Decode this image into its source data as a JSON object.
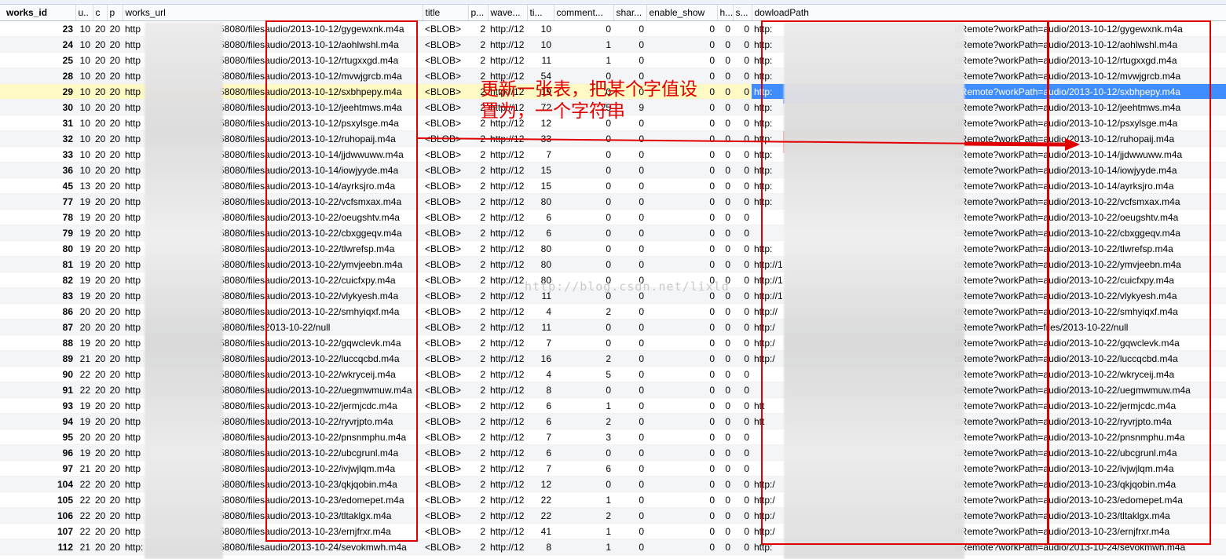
{
  "columns": [
    "works_id",
    "u..",
    "c",
    "p",
    "works_url",
    "title",
    "p...",
    "wave...",
    "ti...",
    "comment...",
    "shar...",
    "enable_show",
    "h...",
    "s...",
    "dowloadPath"
  ],
  "rows": [
    {
      "id": "23",
      "u": "10",
      "c": "20",
      "p": "20",
      "url_pre": "http",
      "url_mid": "58080/files",
      "url_path": "audio/2013-10-12/gygewxnk.m4a",
      "title": "<BLOB>",
      "p2": "2",
      "wave": "http://12",
      "ti": "10",
      "comment": "0",
      "share": "0",
      "enable": "0",
      "h": "0",
      "s": "0",
      "dl_pre": "http:",
      "dl_mid": "dRemote?workPath=",
      "dl_path": "audio/2013-10-12/gygewxnk.m4a"
    },
    {
      "id": "24",
      "u": "10",
      "c": "20",
      "p": "20",
      "url_pre": "http",
      "url_mid": "58080/files",
      "url_path": "audio/2013-10-12/aohlwshl.m4a",
      "title": "<BLOB>",
      "p2": "2",
      "wave": "http://12",
      "ti": "10",
      "comment": "1",
      "share": "0",
      "enable": "0",
      "h": "0",
      "s": "0",
      "dl_pre": "http:",
      "dl_mid": "dRemote?workPath=",
      "dl_path": "audio/2013-10-12/aohlwshl.m4a"
    },
    {
      "id": "25",
      "u": "10",
      "c": "20",
      "p": "20",
      "url_pre": "http",
      "url_mid": "58080/files",
      "url_path": "audio/2013-10-12/rtugxxgd.m4a",
      "title": "<BLOB>",
      "p2": "2",
      "wave": "http://12",
      "ti": "11",
      "comment": "1",
      "share": "0",
      "enable": "0",
      "h": "0",
      "s": "0",
      "dl_pre": "http:",
      "dl_mid": "dRemote?workPath=",
      "dl_path": "audio/2013-10-12/rtugxxgd.m4a"
    },
    {
      "id": "28",
      "u": "10",
      "c": "20",
      "p": "20",
      "url_pre": "http",
      "url_mid": "58080/files",
      "url_path": "audio/2013-10-12/mvwjgrcb.m4a",
      "title": "<BLOB>",
      "p2": "2",
      "wave": "http://12",
      "ti": "54",
      "comment": "0",
      "share": "0",
      "enable": "0",
      "h": "0",
      "s": "0",
      "dl_pre": "http:",
      "dl_mid": "dRemote?workPath=",
      "dl_path": "audio/2013-10-12/mvwjgrcb.m4a"
    },
    {
      "id": "29",
      "u": "10",
      "c": "20",
      "p": "20",
      "url_pre": "http",
      "url_mid": "58080/files",
      "url_path": "audio/2013-10-12/sxbhpepy.m4a",
      "title": "<BLOB>",
      "p2": "2",
      "wave": "http://12",
      "ti": "19",
      "comment": "0",
      "share": "0",
      "enable": "0",
      "h": "0",
      "s": "0",
      "dl_pre": "http:",
      "dl_mid": "dRemote?workPath=",
      "dl_path": "audio/2013-10-12/sxbhpepy.m4a"
    },
    {
      "id": "30",
      "u": "10",
      "c": "20",
      "p": "20",
      "url_pre": "http",
      "url_mid": "58080/files",
      "url_path": "audio/2013-10-12/jeehtmws.m4a",
      "title": "<BLOB>",
      "p2": "2",
      "wave": "http://12",
      "ti": "72",
      "comment": "25",
      "share": "9",
      "enable": "0",
      "h": "0",
      "s": "0",
      "dl_pre": "http:",
      "dl_mid": "dRemote?workPath=",
      "dl_path": "audio/2013-10-12/jeehtmws.m4a"
    },
    {
      "id": "31",
      "u": "10",
      "c": "20",
      "p": "20",
      "url_pre": "http",
      "url_mid": "58080/files",
      "url_path": "audio/2013-10-12/psxylsge.m4a",
      "title": "<BLOB>",
      "p2": "2",
      "wave": "http://12",
      "ti": "12",
      "comment": "0",
      "share": "0",
      "enable": "0",
      "h": "0",
      "s": "0",
      "dl_pre": "http:",
      "dl_mid": "dRemote?workPath=",
      "dl_path": "audio/2013-10-12/psxylsge.m4a"
    },
    {
      "id": "32",
      "u": "10",
      "c": "20",
      "p": "20",
      "url_pre": "http",
      "url_mid": "58080/files",
      "url_path": "audio/2013-10-12/ruhopaij.m4a",
      "title": "<BLOB>",
      "p2": "2",
      "wave": "http://12",
      "ti": "33",
      "comment": "0",
      "share": "0",
      "enable": "0",
      "h": "0",
      "s": "0",
      "dl_pre": "http:",
      "dl_mid": "dRemote?workPath=",
      "dl_path": "audio/2013-10-12/ruhopaij.m4a"
    },
    {
      "id": "33",
      "u": "10",
      "c": "20",
      "p": "20",
      "url_pre": "http",
      "url_mid": "58080/files",
      "url_path": "audio/2013-10-14/jjdwwuww.m4a",
      "title": "<BLOB>",
      "p2": "2",
      "wave": "http://12",
      "ti": "7",
      "comment": "0",
      "share": "0",
      "enable": "0",
      "h": "0",
      "s": "0",
      "dl_pre": "http:",
      "dl_mid": "dRemote?workPath=",
      "dl_path": "audio/2013-10-14/jjdwwuww.m4a"
    },
    {
      "id": "36",
      "u": "10",
      "c": "20",
      "p": "20",
      "url_pre": "http",
      "url_mid": "58080/files",
      "url_path": "audio/2013-10-14/iowjyyde.m4a",
      "title": "<BLOB>",
      "p2": "2",
      "wave": "http://12",
      "ti": "15",
      "comment": "0",
      "share": "0",
      "enable": "0",
      "h": "0",
      "s": "0",
      "dl_pre": "http:",
      "dl_mid": "dRemote?workPath=",
      "dl_path": "audio/2013-10-14/iowjyyde.m4a"
    },
    {
      "id": "45",
      "u": "13",
      "c": "20",
      "p": "20",
      "url_pre": "http",
      "url_mid": "58080/files",
      "url_path": "audio/2013-10-14/ayrksjro.m4a",
      "title": "<BLOB>",
      "p2": "2",
      "wave": "http://12",
      "ti": "15",
      "comment": "0",
      "share": "0",
      "enable": "0",
      "h": "0",
      "s": "0",
      "dl_pre": "http:",
      "dl_mid": "dRemote?workPath=",
      "dl_path": "audio/2013-10-14/ayrksjro.m4a"
    },
    {
      "id": "77",
      "u": "19",
      "c": "20",
      "p": "20",
      "url_pre": "http",
      "url_mid": "58080/files",
      "url_path": "audio/2013-10-22/vcfsmxax.m4a",
      "title": "<BLOB>",
      "p2": "2",
      "wave": "http://12",
      "ti": "80",
      "comment": "0",
      "share": "0",
      "enable": "0",
      "h": "0",
      "s": "0",
      "dl_pre": "http:",
      "dl_mid": "dRemote?workPath=",
      "dl_path": "audio/2013-10-22/vcfsmxax.m4a"
    },
    {
      "id": "78",
      "u": "19",
      "c": "20",
      "p": "20",
      "url_pre": "http",
      "url_mid": "58080/files",
      "url_path": "audio/2013-10-22/oeugshtv.m4a",
      "title": "<BLOB>",
      "p2": "2",
      "wave": "http://12",
      "ti": "6",
      "comment": "0",
      "share": "0",
      "enable": "0",
      "h": "0",
      "s": "0",
      "dl_pre": "",
      "dl_mid": "dRemote?workPath=",
      "dl_path": "audio/2013-10-22/oeugshtv.m4a"
    },
    {
      "id": "79",
      "u": "19",
      "c": "20",
      "p": "20",
      "url_pre": "http",
      "url_mid": "58080/files",
      "url_path": "audio/2013-10-22/cbxggeqv.m4a",
      "title": "<BLOB>",
      "p2": "2",
      "wave": "http://12",
      "ti": "6",
      "comment": "0",
      "share": "0",
      "enable": "0",
      "h": "0",
      "s": "0",
      "dl_pre": "",
      "dl_mid": "dRemote?workPath=",
      "dl_path": "audio/2013-10-22/cbxggeqv.m4a"
    },
    {
      "id": "80",
      "u": "19",
      "c": "20",
      "p": "20",
      "url_pre": "http",
      "url_mid": "58080/files",
      "url_path": "audio/2013-10-22/tlwrefsp.m4a",
      "title": "<BLOB>",
      "p2": "2",
      "wave": "http://12",
      "ti": "80",
      "comment": "0",
      "share": "0",
      "enable": "0",
      "h": "0",
      "s": "0",
      "dl_pre": "http:",
      "dl_mid": "dRemote?workPath=",
      "dl_path": "audio/2013-10-22/tlwrefsp.m4a"
    },
    {
      "id": "81",
      "u": "19",
      "c": "20",
      "p": "20",
      "url_pre": "http",
      "url_mid": "58080/files",
      "url_path": "audio/2013-10-22/ymvjeebn.m4a",
      "title": "<BLOB>",
      "p2": "2",
      "wave": "http://12",
      "ti": "80",
      "comment": "0",
      "share": "0",
      "enable": "0",
      "h": "0",
      "s": "0",
      "dl_pre": "http://1",
      "dl_mid": "dRemote?workPath=",
      "dl_path": "audio/2013-10-22/ymvjeebn.m4a"
    },
    {
      "id": "82",
      "u": "19",
      "c": "20",
      "p": "20",
      "url_pre": "http",
      "url_mid": "58080/files",
      "url_path": "audio/2013-10-22/cuicfxpy.m4a",
      "title": "<BLOB>",
      "p2": "2",
      "wave": "http://12",
      "ti": "80",
      "comment": "0",
      "share": "0",
      "enable": "0",
      "h": "0",
      "s": "0",
      "dl_pre": "http://1",
      "dl_mid": "dRemote?workPath=",
      "dl_path": "audio/2013-10-22/cuicfxpy.m4a"
    },
    {
      "id": "83",
      "u": "19",
      "c": "20",
      "p": "20",
      "url_pre": "http",
      "url_mid": "58080/files",
      "url_path": "audio/2013-10-22/vlykyesh.m4a",
      "title": "<BLOB>",
      "p2": "2",
      "wave": "http://12",
      "ti": "11",
      "comment": "0",
      "share": "0",
      "enable": "0",
      "h": "0",
      "s": "0",
      "dl_pre": "http://1",
      "dl_mid": "dRemote?workPath=",
      "dl_path": "audio/2013-10-22/vlykyesh.m4a"
    },
    {
      "id": "86",
      "u": "20",
      "c": "20",
      "p": "20",
      "url_pre": "http",
      "url_mid": "58080/files",
      "url_path": "audio/2013-10-22/smhyiqxf.m4a",
      "title": "<BLOB>",
      "p2": "2",
      "wave": "http://12",
      "ti": "4",
      "comment": "2",
      "share": "0",
      "enable": "0",
      "h": "0",
      "s": "0",
      "dl_pre": "http://",
      "dl_mid": "dRemote?workPath=",
      "dl_path": "audio/2013-10-22/smhyiqxf.m4a"
    },
    {
      "id": "87",
      "u": "20",
      "c": "20",
      "p": "20",
      "url_pre": "http",
      "url_mid": "58080/files",
      "url_path": "2013-10-22/null",
      "title": "<BLOB>",
      "p2": "2",
      "wave": "http://12",
      "ti": "11",
      "comment": "0",
      "share": "0",
      "enable": "0",
      "h": "0",
      "s": "0",
      "dl_pre": "http:/",
      "dl_mid": "dRemote?workPath=",
      "dl_path": "files/2013-10-22/null"
    },
    {
      "id": "88",
      "u": "19",
      "c": "20",
      "p": "20",
      "url_pre": "http",
      "url_mid": "58080/files",
      "url_path": "audio/2013-10-22/gqwclevk.m4a",
      "title": "<BLOB>",
      "p2": "2",
      "wave": "http://12",
      "ti": "7",
      "comment": "0",
      "share": "0",
      "enable": "0",
      "h": "0",
      "s": "0",
      "dl_pre": "http:/",
      "dl_mid": "dRemote?workPath=",
      "dl_path": "audio/2013-10-22/gqwclevk.m4a"
    },
    {
      "id": "89",
      "u": "21",
      "c": "20",
      "p": "20",
      "url_pre": "http",
      "url_mid": "58080/files",
      "url_path": "audio/2013-10-22/luccqcbd.m4a",
      "title": "<BLOB>",
      "p2": "2",
      "wave": "http://12",
      "ti": "16",
      "comment": "2",
      "share": "0",
      "enable": "0",
      "h": "0",
      "s": "0",
      "dl_pre": "http:/",
      "dl_mid": "dRemote?workPath=",
      "dl_path": "audio/2013-10-22/luccqcbd.m4a"
    },
    {
      "id": "90",
      "u": "22",
      "c": "20",
      "p": "20",
      "url_pre": "http",
      "url_mid": "58080/files",
      "url_path": "audio/2013-10-22/wkryceij.m4a",
      "title": "<BLOB>",
      "p2": "2",
      "wave": "http://12",
      "ti": "4",
      "comment": "5",
      "share": "0",
      "enable": "0",
      "h": "0",
      "s": "0",
      "dl_pre": "",
      "dl_mid": "dRemote?workPath=",
      "dl_path": "audio/2013-10-22/wkryceij.m4a"
    },
    {
      "id": "91",
      "u": "22",
      "c": "20",
      "p": "20",
      "url_pre": "http",
      "url_mid": "58080/files",
      "url_path": "audio/2013-10-22/uegmwmuw.m4a",
      "title": "<BLOB>",
      "p2": "2",
      "wave": "http://12",
      "ti": "8",
      "comment": "0",
      "share": "0",
      "enable": "0",
      "h": "0",
      "s": "0",
      "dl_pre": "",
      "dl_mid": "dRemote?workPath=",
      "dl_path": "audio/2013-10-22/uegmwmuw.m4a"
    },
    {
      "id": "93",
      "u": "19",
      "c": "20",
      "p": "20",
      "url_pre": "http",
      "url_mid": "58080/files",
      "url_path": "audio/2013-10-22/jermjcdc.m4a",
      "title": "<BLOB>",
      "p2": "2",
      "wave": "http://12",
      "ti": "6",
      "comment": "1",
      "share": "0",
      "enable": "0",
      "h": "0",
      "s": "0",
      "dl_pre": "htt",
      "dl_mid": "dRemote?workPath=",
      "dl_path": "audio/2013-10-22/jermjcdc.m4a"
    },
    {
      "id": "94",
      "u": "19",
      "c": "20",
      "p": "20",
      "url_pre": "http",
      "url_mid": "58080/files",
      "url_path": "audio/2013-10-22/ryvrjpto.m4a",
      "title": "<BLOB>",
      "p2": "2",
      "wave": "http://12",
      "ti": "6",
      "comment": "2",
      "share": "0",
      "enable": "0",
      "h": "0",
      "s": "0",
      "dl_pre": "htt",
      "dl_mid": "dRemote?workPath=",
      "dl_path": "audio/2013-10-22/ryvrjpto.m4a"
    },
    {
      "id": "95",
      "u": "20",
      "c": "20",
      "p": "20",
      "url_pre": "http",
      "url_mid": "58080/files",
      "url_path": "audio/2013-10-22/pnsnmphu.m4a",
      "title": "<BLOB>",
      "p2": "2",
      "wave": "http://12",
      "ti": "7",
      "comment": "3",
      "share": "0",
      "enable": "0",
      "h": "0",
      "s": "0",
      "dl_pre": "",
      "dl_mid": "dRemote?workPath=",
      "dl_path": "audio/2013-10-22/pnsnmphu.m4a"
    },
    {
      "id": "96",
      "u": "19",
      "c": "20",
      "p": "20",
      "url_pre": "http",
      "url_mid": "58080/files",
      "url_path": "audio/2013-10-22/ubcgrunl.m4a",
      "title": "<BLOB>",
      "p2": "2",
      "wave": "http://12",
      "ti": "6",
      "comment": "0",
      "share": "0",
      "enable": "0",
      "h": "0",
      "s": "0",
      "dl_pre": "",
      "dl_mid": "dRemote?workPath=",
      "dl_path": "audio/2013-10-22/ubcgrunl.m4a"
    },
    {
      "id": "97",
      "u": "21",
      "c": "20",
      "p": "20",
      "url_pre": "http",
      "url_mid": "58080/files",
      "url_path": "audio/2013-10-22/ivjwjlqm.m4a",
      "title": "<BLOB>",
      "p2": "2",
      "wave": "http://12",
      "ti": "7",
      "comment": "6",
      "share": "0",
      "enable": "0",
      "h": "0",
      "s": "0",
      "dl_pre": "",
      "dl_mid": "dRemote?workPath=",
      "dl_path": "audio/2013-10-22/ivjwjlqm.m4a"
    },
    {
      "id": "104",
      "u": "22",
      "c": "20",
      "p": "20",
      "url_pre": "http",
      "url_mid": "58080/files",
      "url_path": "audio/2013-10-23/qkjqobin.m4a",
      "title": "<BLOB>",
      "p2": "2",
      "wave": "http://12",
      "ti": "12",
      "comment": "0",
      "share": "0",
      "enable": "0",
      "h": "0",
      "s": "0",
      "dl_pre": "http:/",
      "dl_mid": "dRemote?workPath=",
      "dl_path": "audio/2013-10-23/qkjqobin.m4a"
    },
    {
      "id": "105",
      "u": "22",
      "c": "20",
      "p": "20",
      "url_pre": "http",
      "url_mid": "58080/files",
      "url_path": "audio/2013-10-23/edomepet.m4a",
      "title": "<BLOB>",
      "p2": "2",
      "wave": "http://12",
      "ti": "22",
      "comment": "1",
      "share": "0",
      "enable": "0",
      "h": "0",
      "s": "0",
      "dl_pre": "http:/",
      "dl_mid": "dRemote?workPath=",
      "dl_path": "audio/2013-10-23/edomepet.m4a"
    },
    {
      "id": "106",
      "u": "22",
      "c": "20",
      "p": "20",
      "url_pre": "http",
      "url_mid": "58080/files",
      "url_path": "audio/2013-10-23/tltaklgx.m4a",
      "title": "<BLOB>",
      "p2": "2",
      "wave": "http://12",
      "ti": "22",
      "comment": "2",
      "share": "0",
      "enable": "0",
      "h": "0",
      "s": "0",
      "dl_pre": "http:/",
      "dl_mid": "dRemote?workPath=",
      "dl_path": "audio/2013-10-23/tltaklgx.m4a"
    },
    {
      "id": "107",
      "u": "22",
      "c": "20",
      "p": "20",
      "url_pre": "http",
      "url_mid": "58080/files",
      "url_path": "audio/2013-10-23/ernjfrxr.m4a",
      "title": "<BLOB>",
      "p2": "2",
      "wave": "http://12",
      "ti": "41",
      "comment": "1",
      "share": "0",
      "enable": "0",
      "h": "0",
      "s": "0",
      "dl_pre": "http:/",
      "dl_mid": "dRemote?workPath=",
      "dl_path": "audio/2013-10-23/ernjfrxr.m4a"
    },
    {
      "id": "112",
      "u": "21",
      "c": "20",
      "p": "20",
      "url_pre": "http:",
      "url_mid": "58080/files",
      "url_path": "audio/2013-10-24/sevokmwh.m4a",
      "title": "<BLOB>",
      "p2": "2",
      "wave": "http://12",
      "ti": "8",
      "comment": "1",
      "share": "0",
      "enable": "0",
      "h": "0",
      "s": "0",
      "dl_pre": "http:",
      "dl_mid": "dRemote?workPath=",
      "dl_path": "audio/2013-10-24/sevokmwh.m4a"
    }
  ],
  "highlighted_row_index": 4,
  "annotation": {
    "line1": "更新一张表，把某个字值设",
    "line2": "置为，一个字符串"
  },
  "watermark": "http://blog.csdn.net/lixld",
  "colors": {
    "annotation": "#e00000",
    "selection": "#3f8cff",
    "highlight_row": "#fff9c4"
  }
}
